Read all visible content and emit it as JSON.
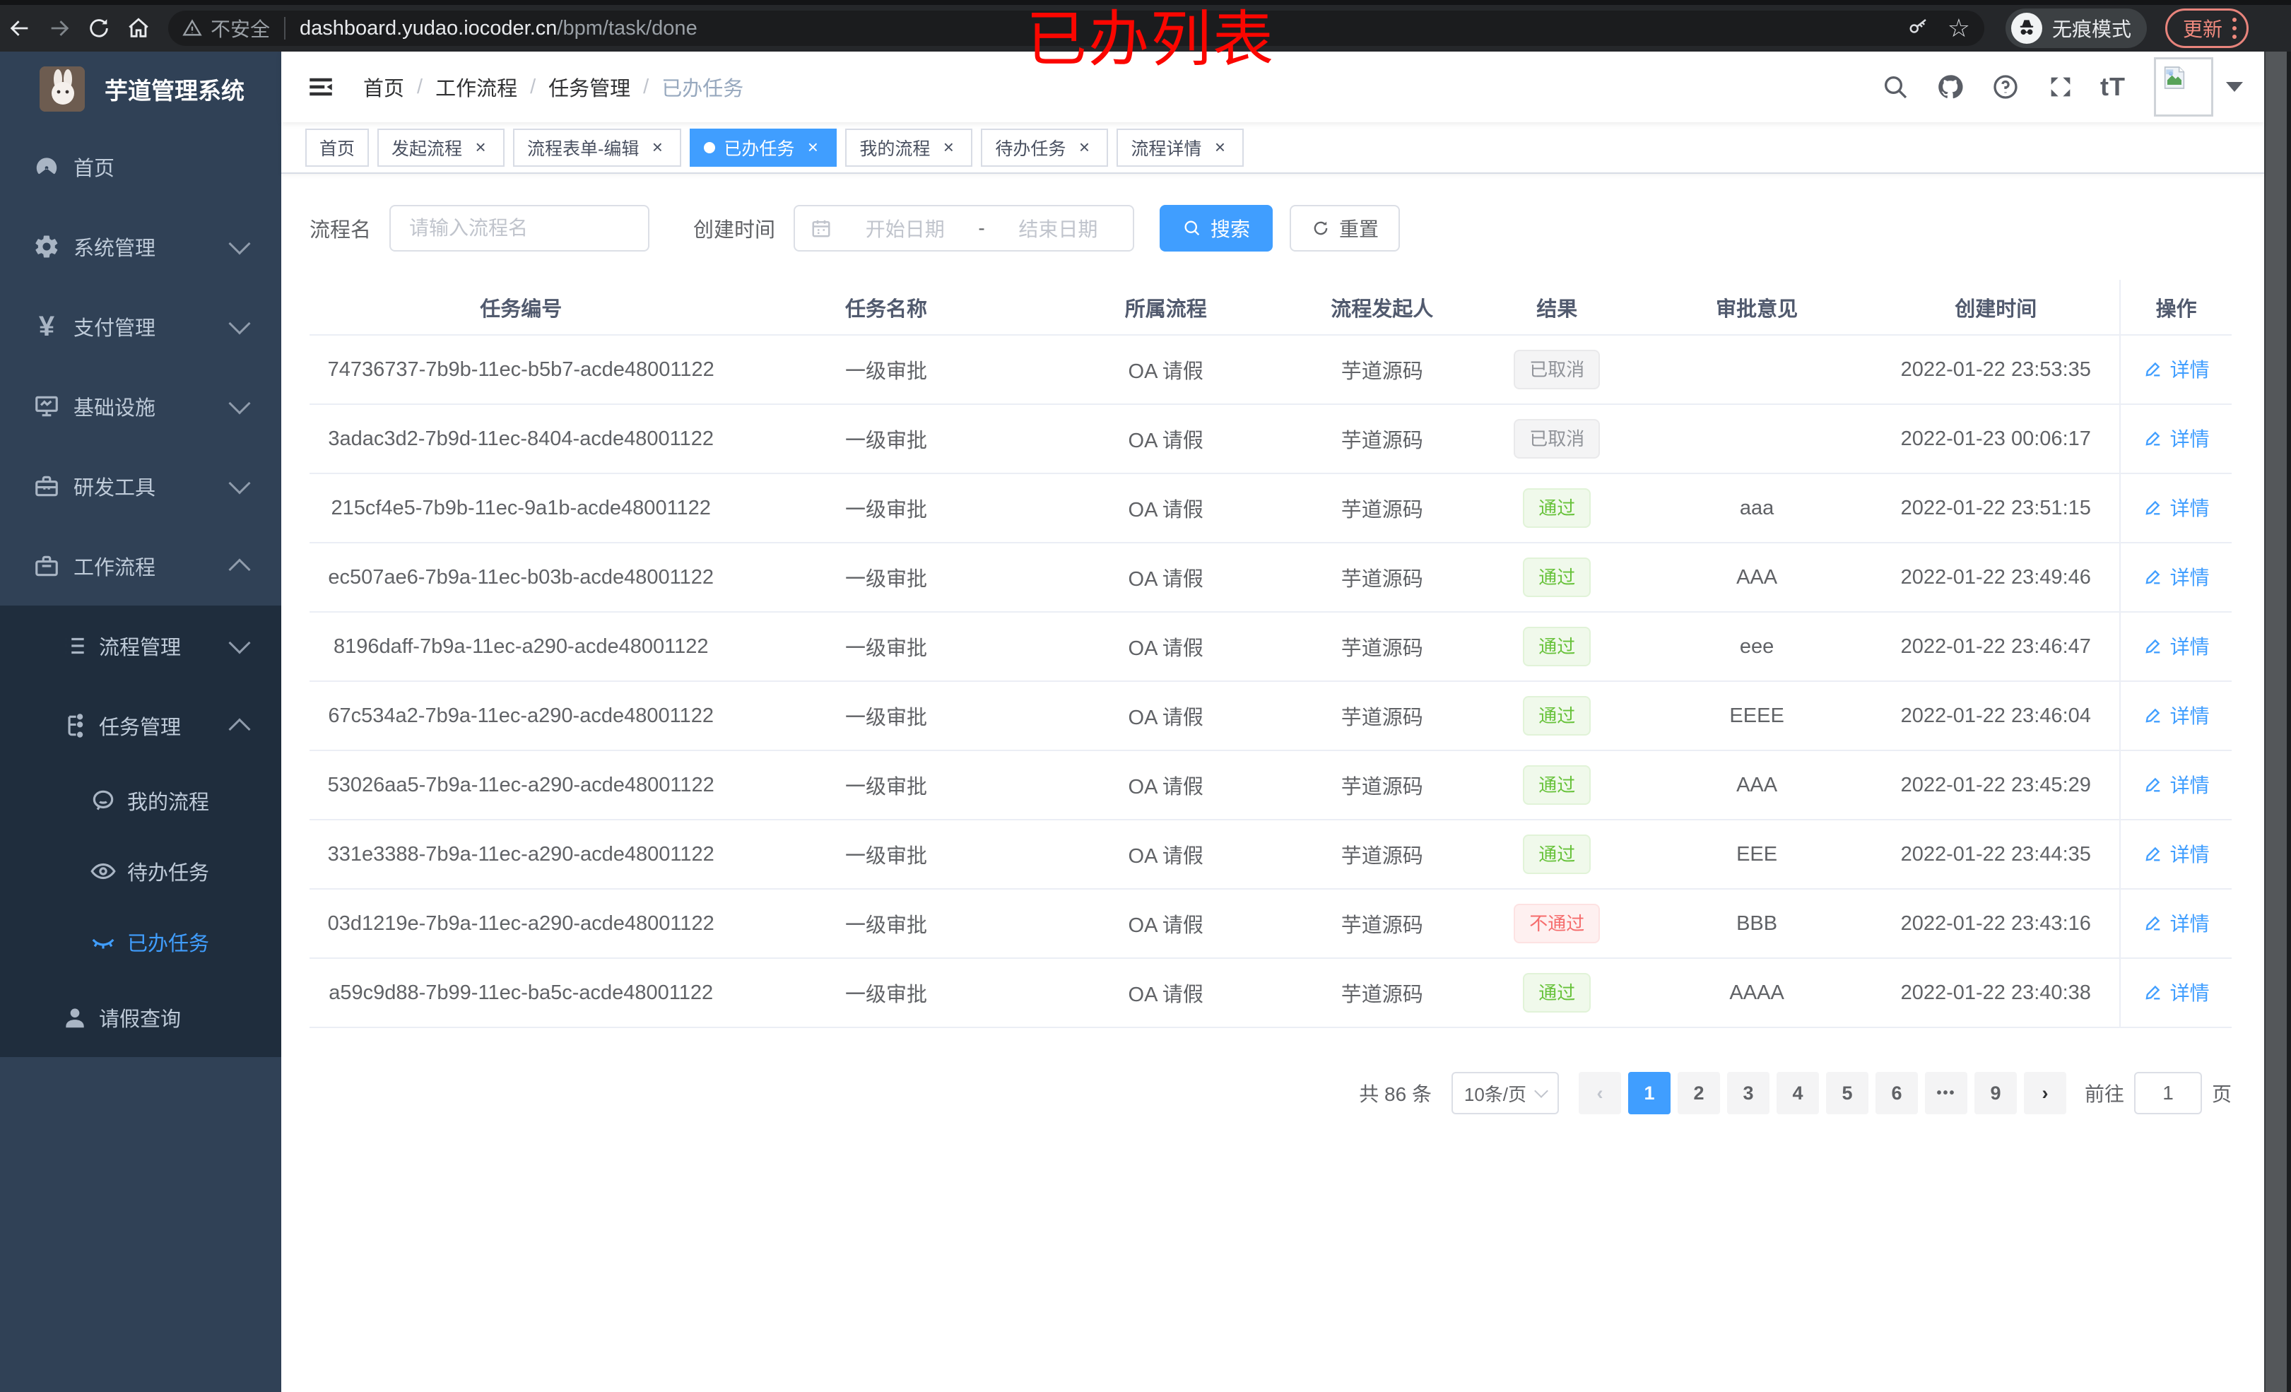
{
  "ui": {
    "close_glyph": "×",
    "breadcrumb_separator": "/",
    "ellipsis_glyph": "•••",
    "prev_glyph": "‹",
    "next_glyph": "›",
    "font_size_glyph": "tT",
    "star_glyph": "☆"
  },
  "browser": {
    "security_label": "不安全",
    "url_host": "dashboard.yudao.iocoder.cn",
    "url_path": "/bpm/task/done",
    "incognito_label": "无痕模式",
    "update_label": "更新"
  },
  "annotation": {
    "text": "已办列表",
    "color": "#fb0600"
  },
  "sidebar": {
    "title": "芋道管理系统",
    "menu": [
      {
        "label": "首页",
        "icon": "dashboard-icon"
      },
      {
        "label": "系统管理",
        "icon": "gear-icon"
      },
      {
        "label": "支付管理",
        "icon": "yen-icon",
        "yen": "¥"
      },
      {
        "label": "基础设施",
        "icon": "monitor-icon"
      },
      {
        "label": "研发工具",
        "icon": "toolbox-icon"
      },
      {
        "label": "工作流程",
        "icon": "briefcase-icon"
      },
      {
        "label": "流程管理",
        "icon": "list-tree-icon"
      },
      {
        "label": "任务管理",
        "icon": "flow-tree-icon"
      },
      {
        "label": "我的流程",
        "icon": "face-icon"
      },
      {
        "label": "待办任务",
        "icon": "eye-open-icon"
      },
      {
        "label": "已办任务",
        "icon": "eye-closed-icon"
      },
      {
        "label": "请假查询",
        "icon": "user-icon"
      }
    ]
  },
  "header": {
    "breadcrumb": [
      "首页",
      "工作流程",
      "任务管理",
      "已办任务"
    ]
  },
  "tabs": [
    {
      "label": "首页"
    },
    {
      "label": "发起流程"
    },
    {
      "label": "流程表单-编辑"
    },
    {
      "label": "已办任务"
    },
    {
      "label": "我的流程"
    },
    {
      "label": "待办任务"
    },
    {
      "label": "流程详情"
    }
  ],
  "filters": {
    "name_label": "流程名",
    "name_placeholder": "请输入流程名",
    "time_label": "创建时间",
    "start_placeholder": "开始日期",
    "range_separator": "-",
    "end_placeholder": "结束日期",
    "search_label": "搜索",
    "reset_label": "重置"
  },
  "table": {
    "columns": [
      "任务编号",
      "任务名称",
      "所属流程",
      "流程发起人",
      "结果",
      "审批意见",
      "创建时间",
      "操作"
    ],
    "action_label": "详情",
    "rows": [
      {
        "id": "74736737-7b9b-11ec-b5b7-acde48001122",
        "name": "一级审批",
        "process": "OA 请假",
        "starter": "芋道源码",
        "result": "已取消",
        "result_type": "info",
        "comment": "",
        "created": "2022-01-22 23:53:35"
      },
      {
        "id": "3adac3d2-7b9d-11ec-8404-acde48001122",
        "name": "一级审批",
        "process": "OA 请假",
        "starter": "芋道源码",
        "result": "已取消",
        "result_type": "info",
        "comment": "",
        "created": "2022-01-23 00:06:17"
      },
      {
        "id": "215cf4e5-7b9b-11ec-9a1b-acde48001122",
        "name": "一级审批",
        "process": "OA 请假",
        "starter": "芋道源码",
        "result": "通过",
        "result_type": "success",
        "comment": "aaa",
        "created": "2022-01-22 23:51:15"
      },
      {
        "id": "ec507ae6-7b9a-11ec-b03b-acde48001122",
        "name": "一级审批",
        "process": "OA 请假",
        "starter": "芋道源码",
        "result": "通过",
        "result_type": "success",
        "comment": "AAA",
        "created": "2022-01-22 23:49:46"
      },
      {
        "id": "8196daff-7b9a-11ec-a290-acde48001122",
        "name": "一级审批",
        "process": "OA 请假",
        "starter": "芋道源码",
        "result": "通过",
        "result_type": "success",
        "comment": "eee",
        "created": "2022-01-22 23:46:47"
      },
      {
        "id": "67c534a2-7b9a-11ec-a290-acde48001122",
        "name": "一级审批",
        "process": "OA 请假",
        "starter": "芋道源码",
        "result": "通过",
        "result_type": "success",
        "comment": "EEEE",
        "created": "2022-01-22 23:46:04"
      },
      {
        "id": "53026aa5-7b9a-11ec-a290-acde48001122",
        "name": "一级审批",
        "process": "OA 请假",
        "starter": "芋道源码",
        "result": "通过",
        "result_type": "success",
        "comment": "AAA",
        "created": "2022-01-22 23:45:29"
      },
      {
        "id": "331e3388-7b9a-11ec-a290-acde48001122",
        "name": "一级审批",
        "process": "OA 请假",
        "starter": "芋道源码",
        "result": "通过",
        "result_type": "success",
        "comment": "EEE",
        "created": "2022-01-22 23:44:35"
      },
      {
        "id": "03d1219e-7b9a-11ec-a290-acde48001122",
        "name": "一级审批",
        "process": "OA 请假",
        "starter": "芋道源码",
        "result": "不通过",
        "result_type": "danger",
        "comment": "BBB",
        "created": "2022-01-22 23:43:16"
      },
      {
        "id": "a59c9d88-7b99-11ec-ba5c-acde48001122",
        "name": "一级审批",
        "process": "OA 请假",
        "starter": "芋道源码",
        "result": "通过",
        "result_type": "success",
        "comment": "AAAA",
        "created": "2022-01-22 23:40:38"
      }
    ]
  },
  "pagination": {
    "total_text": "共 86 条",
    "page_size": "10条/页",
    "pages": [
      "1",
      "2",
      "3",
      "4",
      "5",
      "6",
      "9"
    ],
    "active_page": "1",
    "goto_label": "前往",
    "goto_value": "1",
    "goto_suffix": "页"
  }
}
